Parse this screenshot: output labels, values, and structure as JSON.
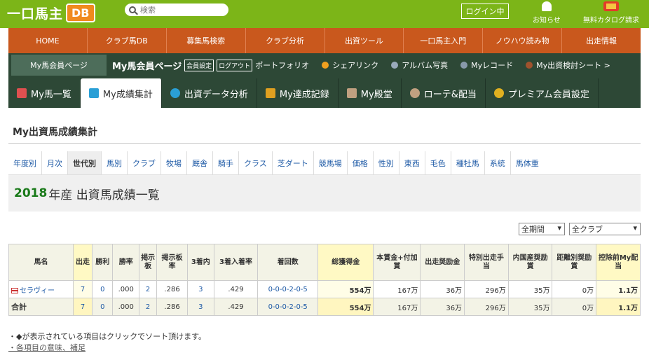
{
  "header": {
    "logo_text": "一口馬主",
    "logo_db": "DB",
    "search_placeholder": "検索",
    "login_label": "ログイン中",
    "notice_label": "お知らせ",
    "catalog_label": "無料カタログ請求"
  },
  "nav1": [
    "HOME",
    "クラブ馬DB",
    "募集馬検索",
    "クラブ分析",
    "出資ツール",
    "一口馬主入門",
    "ノウハウ読み物",
    "出走情報"
  ],
  "nav2": {
    "member_page": "My馬会員ページ",
    "member_title": "My馬会員ページ",
    "box1": "会員設定",
    "box2": "ログアウト",
    "links": [
      "ポートフォリオ",
      "シェアリンク",
      "アルバム写真",
      "Myレコード",
      "My出資検討シート >"
    ]
  },
  "tabs": [
    "My馬一覧",
    "My成績集計",
    "出資データ分析",
    "My達成記録",
    "My殿堂",
    "ローテ&配当",
    "プレミアム会員設定"
  ],
  "section_title": "My出資馬成績集計",
  "subtabs": [
    "年度別",
    "月次",
    "世代別",
    "馬別",
    "クラブ",
    "牧場",
    "厩舎",
    "騎手",
    "クラス",
    "芝ダート",
    "競馬場",
    "価格",
    "性別",
    "東西",
    "毛色",
    "種牡馬",
    "系統",
    "馬体重"
  ],
  "subhead": {
    "year": "2018",
    "text": "年産 出資馬成績一覧"
  },
  "selects": {
    "period": "全期間",
    "club": "全クラブ"
  },
  "table": {
    "headers": [
      "馬名",
      "出走",
      "勝利",
      "勝率",
      "掲示板",
      "掲示板率",
      "3着内",
      "3着入着率",
      "着回数",
      "総獲得金",
      "本賞金+付加賞",
      "出走奨励金",
      "特別出走手当",
      "内国産奨励賞",
      "距離別奨励賞",
      "控除前My配当"
    ],
    "rows": [
      [
        "セラヴィー",
        "7",
        "0",
        ".000",
        "2",
        ".286",
        "3",
        ".429",
        "0-0-0-2-0-5",
        "554万",
        "167万",
        "36万",
        "296万",
        "35万",
        "0万",
        "1.1万"
      ]
    ],
    "total": [
      "合計",
      "7",
      "0",
      ".000",
      "2",
      ".286",
      "3",
      ".429",
      "0-0-0-2-0-5",
      "554万",
      "167万",
      "36万",
      "296万",
      "35万",
      "0万",
      "1.1万"
    ]
  },
  "notes": {
    "sort_note": "・◆が表示されている項目はクリックでソート頂けます。",
    "meaning_link": "・各項目の意味、補足"
  }
}
